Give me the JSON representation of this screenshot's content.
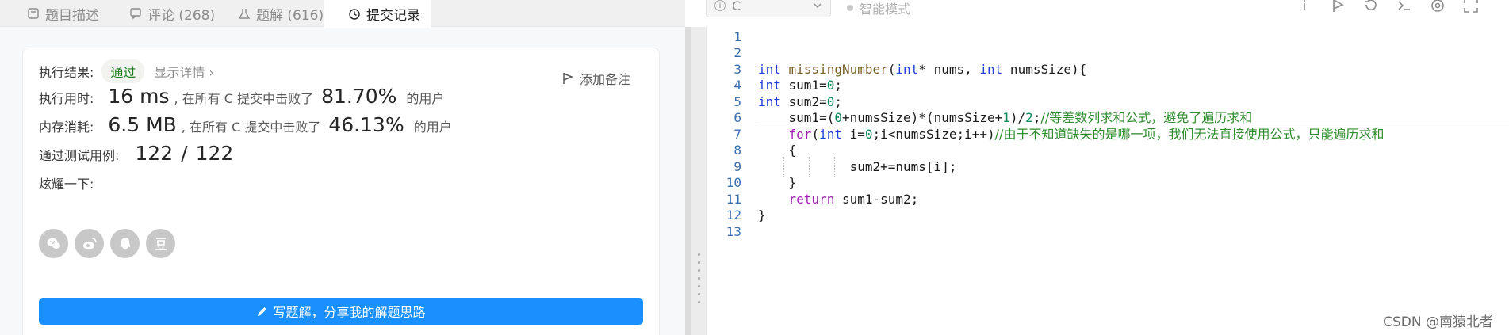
{
  "tabs": [
    {
      "label": "题目描述",
      "icon": "document-icon"
    },
    {
      "label": "评论 (268)",
      "icon": "comment-icon"
    },
    {
      "label": "题解 (616)",
      "icon": "flask-icon"
    },
    {
      "label": "提交记录",
      "icon": "clock-icon",
      "active": true
    }
  ],
  "result": {
    "label": "执行结果:",
    "status": "通过",
    "details": "显示详情 ›",
    "note": "添加备注"
  },
  "runtime": {
    "label": "执行用时:",
    "value": "16 ms",
    "text": ", 在所有 C 提交中击败了",
    "percent": "81.70%",
    "suffix": "的用户"
  },
  "memory": {
    "label": "内存消耗:",
    "value": "6.5 MB",
    "text": ", 在所有 C 提交中击败了",
    "percent": "46.13%",
    "suffix": "的用户"
  },
  "tests": {
    "label": "通过测试用例:",
    "passed": "122",
    "sep": "/",
    "total": "122"
  },
  "share": {
    "label": "炫耀一下:",
    "icons": [
      "wechat-icon",
      "weibo-icon",
      "qq-icon",
      "douban-icon"
    ]
  },
  "write_button": "写题解，分享我的解题思路",
  "toolbar": {
    "language": "C",
    "smart_mode": "智能模式"
  },
  "code": {
    "line_numbers": [
      "1",
      "2",
      "3",
      "4",
      "5",
      "6",
      "7",
      "8",
      "9",
      "10",
      "11",
      "12",
      "13"
    ],
    "l3": {
      "t1": "int",
      "t2": " ",
      "t3": "missingNumber",
      "t4": "(",
      "t5": "int",
      "t6": "* nums, ",
      "t7": "int",
      "t8": " numsSize){"
    },
    "l4": {
      "t1": "int",
      "t2": " sum1=",
      "t3": "0",
      "t4": ";"
    },
    "l5": {
      "t1": "int",
      "t2": " sum2=",
      "t3": "0",
      "t4": ";"
    },
    "l6": {
      "t1": "    sum1=(",
      "t2": "0",
      "t3": "+numsSize)*(numsSize+",
      "t4": "1",
      "t5": ")/",
      "t6": "2",
      "t7": ";",
      "t8": "//等差数列求和公式，避免了遍历求和"
    },
    "l7": {
      "t1": "    ",
      "t2": "for",
      "t3": "(",
      "t4": "int",
      "t5": " i=",
      "t6": "0",
      "t7": ";i<numsSize;i++)",
      "t8": "//由于不知道缺失的是哪一项，我们无法直接使用公式，只能遍历求和"
    },
    "l8": {
      "t1": "    {"
    },
    "l9": {
      "t1": "            sum2+=nums[i];"
    },
    "l10": {
      "t1": "    }"
    },
    "l11": {
      "t1": "    ",
      "t2": "return",
      "t3": " sum1-sum2;"
    },
    "l12": {
      "t1": "}"
    }
  },
  "watermark": "CSDN @南猿北者"
}
